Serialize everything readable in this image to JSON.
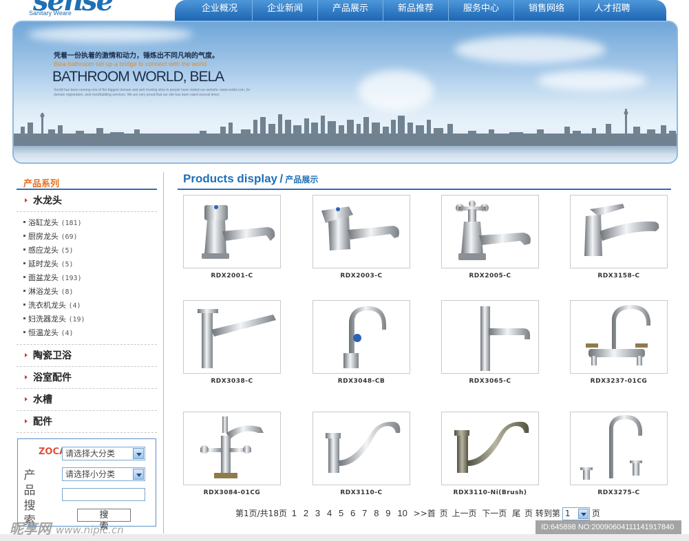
{
  "logo": {
    "word": "sense",
    "sub": "Sanitary Weare"
  },
  "nav": [
    "企业概况",
    "企业新闻",
    "产品展示",
    "新品推荐",
    "服务中心",
    "销售网络",
    "人才招聘"
  ],
  "banner": {
    "cn_line": "凭着一份执着的激情和动力，锤炼出不同凡响的气度。",
    "en_small": "Bela bathroom set up a bridge to connect with the world",
    "title": "BATHROOM WORLD, BELA",
    "para": "Xoxild has been running one of the biggest domain and web hosting sites in people have visited our website. www.xoxild.com, for domain registration, web host/building services. We are very proud that our site has been rated several times"
  },
  "sidebar": {
    "title": "产品系列",
    "category_top": "水龙头",
    "sub_items": [
      {
        "label": "浴缸龙头",
        "count": "(181)"
      },
      {
        "label": "厨房龙头",
        "count": "(69)"
      },
      {
        "label": "感应龙头",
        "count": "(5)"
      },
      {
        "label": "延时龙头",
        "count": "(5)"
      },
      {
        "label": "面盆龙头",
        "count": "(193)"
      },
      {
        "label": "淋浴龙头",
        "count": "(8)"
      },
      {
        "label": "洗衣机龙头",
        "count": "(4)"
      },
      {
        "label": "妇洗器龙头",
        "count": "(19)"
      },
      {
        "label": "恒温龙头",
        "count": "(4)"
      }
    ],
    "categories": [
      "陶瓷卫浴",
      "浴室配件",
      "水槽",
      "配件"
    ]
  },
  "search": {
    "brand": "ZOCALE",
    "label": "产品搜索",
    "select_major": "请选择大分类",
    "select_minor": "请选择小分类",
    "keyword": "",
    "button": "搜 索"
  },
  "main": {
    "title_en": "Products display",
    "title_slash": "/",
    "title_cn": "产品展示"
  },
  "products": [
    {
      "code": "RDX2001-C",
      "icon": "pillar-tap-icon"
    },
    {
      "code": "RDX2003-C",
      "icon": "pillar-tap-icon"
    },
    {
      "code": "RDX2005-C",
      "icon": "cross-handle-tap-icon"
    },
    {
      "code": "RDX3158-C",
      "icon": "single-lever-mixer-icon"
    },
    {
      "code": "RDX3038-C",
      "icon": "pull-out-kitchen-tap-icon"
    },
    {
      "code": "RDX3048-CB",
      "icon": "gooseneck-tap-icon"
    },
    {
      "code": "RDX3065-C",
      "icon": "l-spout-tap-icon"
    },
    {
      "code": "RDX3237-01CG",
      "icon": "two-handle-deck-mixer-icon"
    },
    {
      "code": "RDX3084-01CG",
      "icon": "bidet-mixer-icon"
    },
    {
      "code": "RDX3110-C",
      "icon": "swan-spout-tap-icon"
    },
    {
      "code": "RDX3110-Ni(Brush)",
      "icon": "swan-spout-tap-icon"
    },
    {
      "code": "RDX3275-C",
      "icon": "three-hole-basin-mixer-icon"
    }
  ],
  "pager": {
    "summary": "第1页/共18页",
    "pages": [
      "1",
      "2",
      "3",
      "4",
      "5",
      "6",
      "7",
      "8",
      "9",
      "10"
    ],
    "more": ">>首",
    "first_suffix": "页",
    "prev": "上一页",
    "next": "下一页",
    "last": "尾",
    "last_suffix": "页",
    "goto": "转到第",
    "goto_value": "1",
    "goto_suffix": "页"
  },
  "watermark": {
    "left": "昵享网",
    "left_url": "www.nipic.cn",
    "right": "ID:645898 NO:20090604111141917840"
  },
  "colors": {
    "brand_blue": "#1f6fb5",
    "accent_orange": "#e86e1a",
    "nav_gradient_top": "#4d97d9"
  }
}
